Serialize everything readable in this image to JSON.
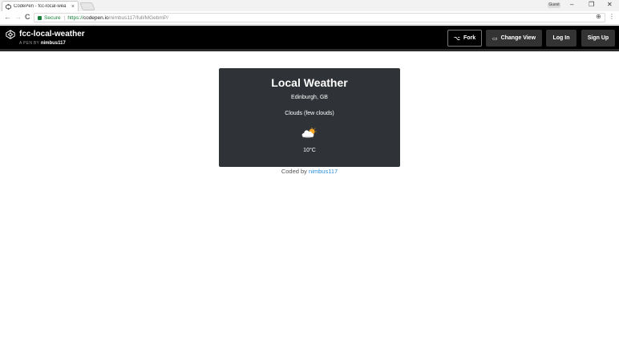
{
  "browser": {
    "tab_title": "CodePen - fcc-local-wea",
    "tab_close": "×",
    "profile_label": "Guest",
    "window_controls": {
      "minimize": "–",
      "maximize": "❐",
      "close": "✕"
    },
    "nav": {
      "back": "←",
      "forward": "→",
      "reload": "C"
    },
    "address": {
      "secure_label": "Secure",
      "scheme": "https://",
      "host": "codepen.io",
      "path": "/nimbus117/full/MGebmP/"
    }
  },
  "header": {
    "pen_title": "fcc-local-weather",
    "pen_by_prefix": "A PEN BY",
    "author": "nimbus117",
    "buttons": {
      "fork": "Fork",
      "change_view": "Change View",
      "log_in": "Log In",
      "sign_up": "Sign Up"
    }
  },
  "weather": {
    "title": "Local Weather",
    "location": "Edinburgh, GB",
    "description": "Clouds (few clouds)",
    "icon": "partly-cloudy-icon",
    "temperature": "10°C"
  },
  "footer": {
    "prefix": "Coded by",
    "link_text": "nimbus117"
  },
  "colors": {
    "card_bg": "#2f3236",
    "header_bg": "#000000",
    "link": "#2a8fd6",
    "secure_green": "#188038"
  }
}
